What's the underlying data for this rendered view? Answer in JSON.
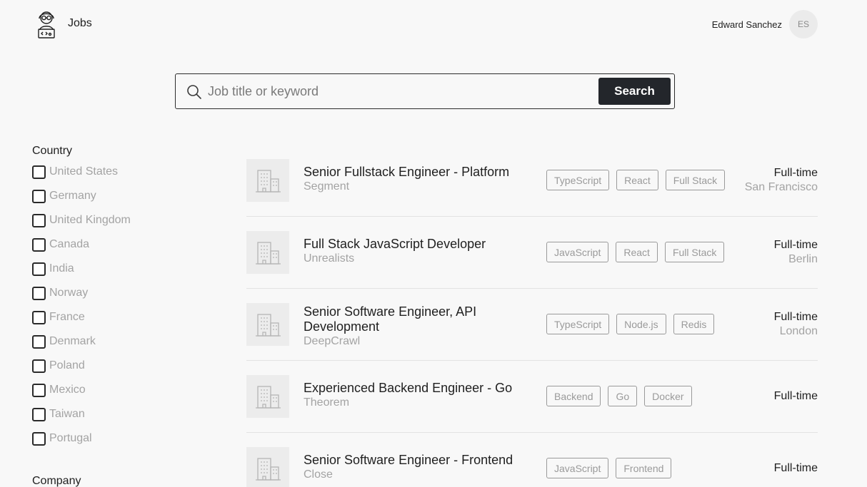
{
  "header": {
    "brand_title": "Jobs",
    "user_name": "Edward Sanchez",
    "user_initials": "ES"
  },
  "search": {
    "placeholder": "Job title or keyword",
    "value": "",
    "button_label": "Search"
  },
  "filters": {
    "country_title": "Country",
    "countries": [
      "United States",
      "Germany",
      "United Kingdom",
      "Canada",
      "India",
      "Norway",
      "France",
      "Denmark",
      "Poland",
      "Mexico",
      "Taiwan",
      "Portugal"
    ],
    "company_title": "Company"
  },
  "jobs": [
    {
      "title": "Senior Fullstack Engineer - Platform",
      "company": "Segment",
      "tags": [
        "TypeScript",
        "React",
        "Full Stack"
      ],
      "type": "Full-time",
      "location": "San Francisco"
    },
    {
      "title": "Full Stack JavaScript Developer",
      "company": "Unrealists",
      "tags": [
        "JavaScript",
        "React",
        "Full Stack"
      ],
      "type": "Full-time",
      "location": "Berlin"
    },
    {
      "title": "Senior Software Engineer, API Development",
      "company": "DeepCrawl",
      "tags": [
        "TypeScript",
        "Node.js",
        "Redis"
      ],
      "type": "Full-time",
      "location": "London"
    },
    {
      "title": "Experienced Backend Engineer - Go",
      "company": "Theorem",
      "tags": [
        "Backend",
        "Go",
        "Docker"
      ],
      "type": "Full-time",
      "location": ""
    },
    {
      "title": "Senior Software Engineer - Frontend",
      "company": "Close",
      "tags": [
        "JavaScript",
        "Frontend"
      ],
      "type": "Full-time",
      "location": ""
    }
  ]
}
